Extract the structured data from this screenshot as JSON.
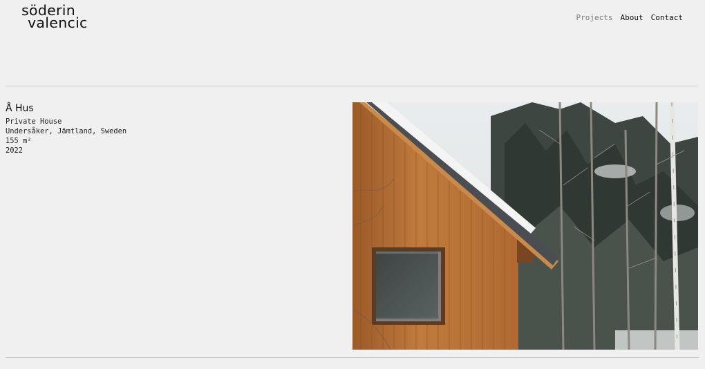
{
  "header": {
    "logo_line1": "söderin",
    "logo_line2": "valencic"
  },
  "nav": {
    "items": [
      {
        "label": "Projects",
        "active": true
      },
      {
        "label": "About",
        "active": false
      },
      {
        "label": "Contact",
        "active": false
      }
    ]
  },
  "project": {
    "title": "Å Hus",
    "type": "Private House",
    "location": "Undersåker, Jämtland, Sweden",
    "area": "155 m²",
    "year": "2022",
    "image_subject": "timber house gable with snowy roof among winter trees"
  },
  "colors": {
    "background": "#f0f0f0",
    "text": "#111111",
    "nav_active": "#7a7a7a",
    "rule": "#c4c4c4",
    "wood": "#b87035"
  }
}
